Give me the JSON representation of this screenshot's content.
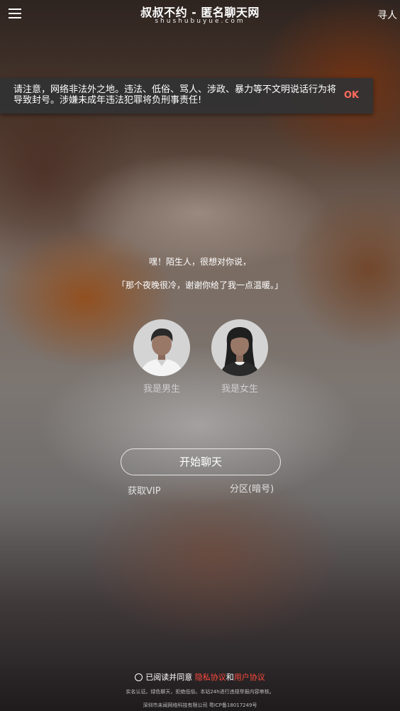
{
  "header": {
    "title": "叔叔不约 - 匿名聊天网",
    "subtitle": "shushubuyue.com",
    "find_label": "寻人"
  },
  "notice": {
    "text": "请注意，网络非法外之地。违法、低俗、骂人、涉政、暴力等不文明说话行为将导致封号。涉嫌未成年违法犯罪将负刑事责任!",
    "ok_label": "OK"
  },
  "greeting": {
    "line1": "嘿！陌生人，很想对你说，",
    "line2": "「那个夜晚很冷，谢谢你给了我一点温暖。」"
  },
  "gender": {
    "male_label": "我是男生",
    "female_label": "我是女生"
  },
  "actions": {
    "start_label": "开始聊天",
    "vip_label": "获取VIP",
    "zone_label": "分区(暗号)"
  },
  "footer": {
    "agree_prefix": "已阅读并同意",
    "privacy_label": "隐私协议",
    "and_text": "和",
    "user_agreement_label": "用户协议",
    "line1": "实名认证。绿色聊天，拒绝低俗。本站24h进行违规举报内容审核。",
    "line2": "深圳市未闻网络科技有限公司 粤ICP备18017249号"
  },
  "colors": {
    "accent_red": "#ff4a3d",
    "ok_red": "#ff6a5c"
  },
  "icons": {
    "menu": "hamburger-menu-icon",
    "male": "male-avatar-icon",
    "female": "female-avatar-icon",
    "radio": "radio-unchecked-icon"
  }
}
